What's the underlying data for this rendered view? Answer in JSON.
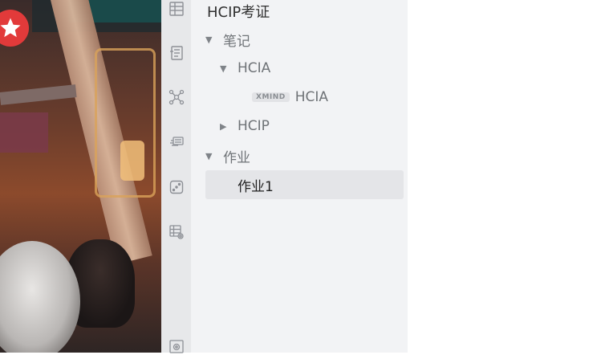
{
  "panel": {
    "title": "HCIP考证",
    "items": [
      {
        "label": "笔记",
        "state": "expanded"
      },
      {
        "label": "HCIA",
        "state": "expanded"
      },
      {
        "label": "HCIA",
        "badge": "XMIND"
      },
      {
        "label": "HCIP",
        "state": "collapsed"
      },
      {
        "label": "作业",
        "state": "expanded"
      },
      {
        "label": "作业1",
        "selected": true
      }
    ]
  },
  "rail": {
    "icons": [
      "table-icon",
      "document-icon",
      "mindmap-icon",
      "cards-icon",
      "dice-icon",
      "table-settings-icon",
      "image-icon"
    ]
  },
  "colors": {
    "rail_bg": "#e7e8ea",
    "panel_bg": "#f2f3f5",
    "selected_bg": "#e4e5e8"
  }
}
